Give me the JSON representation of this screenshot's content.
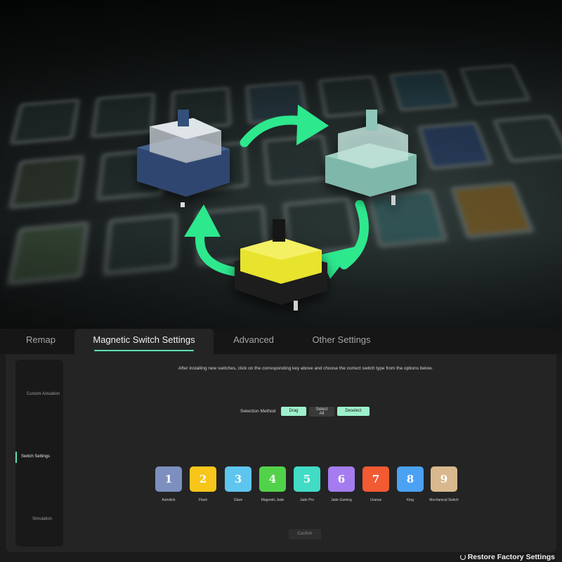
{
  "tabs": [
    {
      "label": "Remap",
      "active": false
    },
    {
      "label": "Magnetic Switch Settings",
      "active": true
    },
    {
      "label": "Advanced",
      "active": false
    },
    {
      "label": "Other Settings",
      "active": false
    }
  ],
  "sidebar": {
    "items": [
      {
        "label": "Custom Actuation",
        "active": false
      },
      {
        "label": "Switch Settings",
        "active": true
      },
      {
        "label": "Simulation",
        "active": false
      }
    ]
  },
  "instruction": "After installing new switches, click on the corresponding key above and choose the correct switch type from the options below.",
  "selection": {
    "label": "Selection Method",
    "drag": "Drag",
    "select_all_line1": "Select",
    "select_all_line2": "All",
    "deselect": "Deselect"
  },
  "switches": [
    {
      "number": "1",
      "name": "Astrolink",
      "color": "#7d8fbf"
    },
    {
      "number": "2",
      "name": "Flash",
      "color": "#f8c61a"
    },
    {
      "number": "3",
      "name": "Glare",
      "color": "#5ec6ee"
    },
    {
      "number": "4",
      "name": "Magnetic Jade",
      "color": "#52d24a"
    },
    {
      "number": "5",
      "name": "Jade Pro",
      "color": "#42dcc6"
    },
    {
      "number": "6",
      "name": "Jade Gaming",
      "color": "#a57cf0"
    },
    {
      "number": "7",
      "name": "Uranus",
      "color": "#f25a32"
    },
    {
      "number": "8",
      "name": "King",
      "color": "#4ba2f2"
    },
    {
      "number": "9",
      "name": "Mechanical Switch",
      "color": "#d9b88e"
    }
  ],
  "confirm_label": "Confirm",
  "restore_label": "Restore Factory Settings",
  "colors": {
    "accent": "#5ee2b2",
    "arrow": "#2ee88e"
  }
}
